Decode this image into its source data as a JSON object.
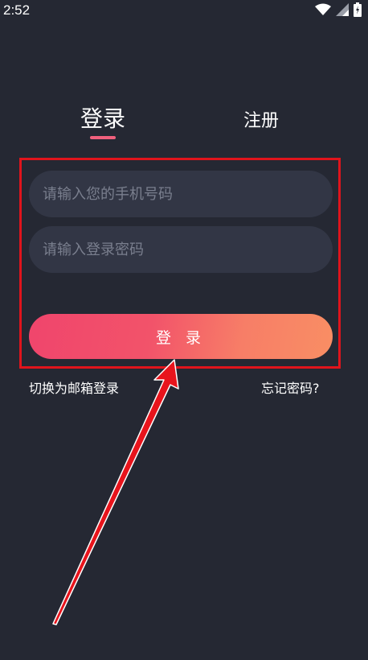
{
  "status_bar": {
    "time": "2:52",
    "icons": [
      "wifi-icon",
      "signal-icon",
      "battery-icon"
    ]
  },
  "tabs": {
    "login": "登录",
    "register": "注册",
    "active": "login"
  },
  "form": {
    "phone_placeholder": "请输入您的手机号码",
    "password_placeholder": "请输入登录密码",
    "submit_label": "登 录"
  },
  "links": {
    "switch_email": "切换为邮箱登录",
    "forgot_password": "忘记密码?"
  },
  "colors": {
    "background": "#252833",
    "input_bg": "#323645",
    "accent": "#f0607d",
    "gradient_start": "#f0456c",
    "gradient_end": "#f98e64",
    "annotation": "#e0141c"
  }
}
